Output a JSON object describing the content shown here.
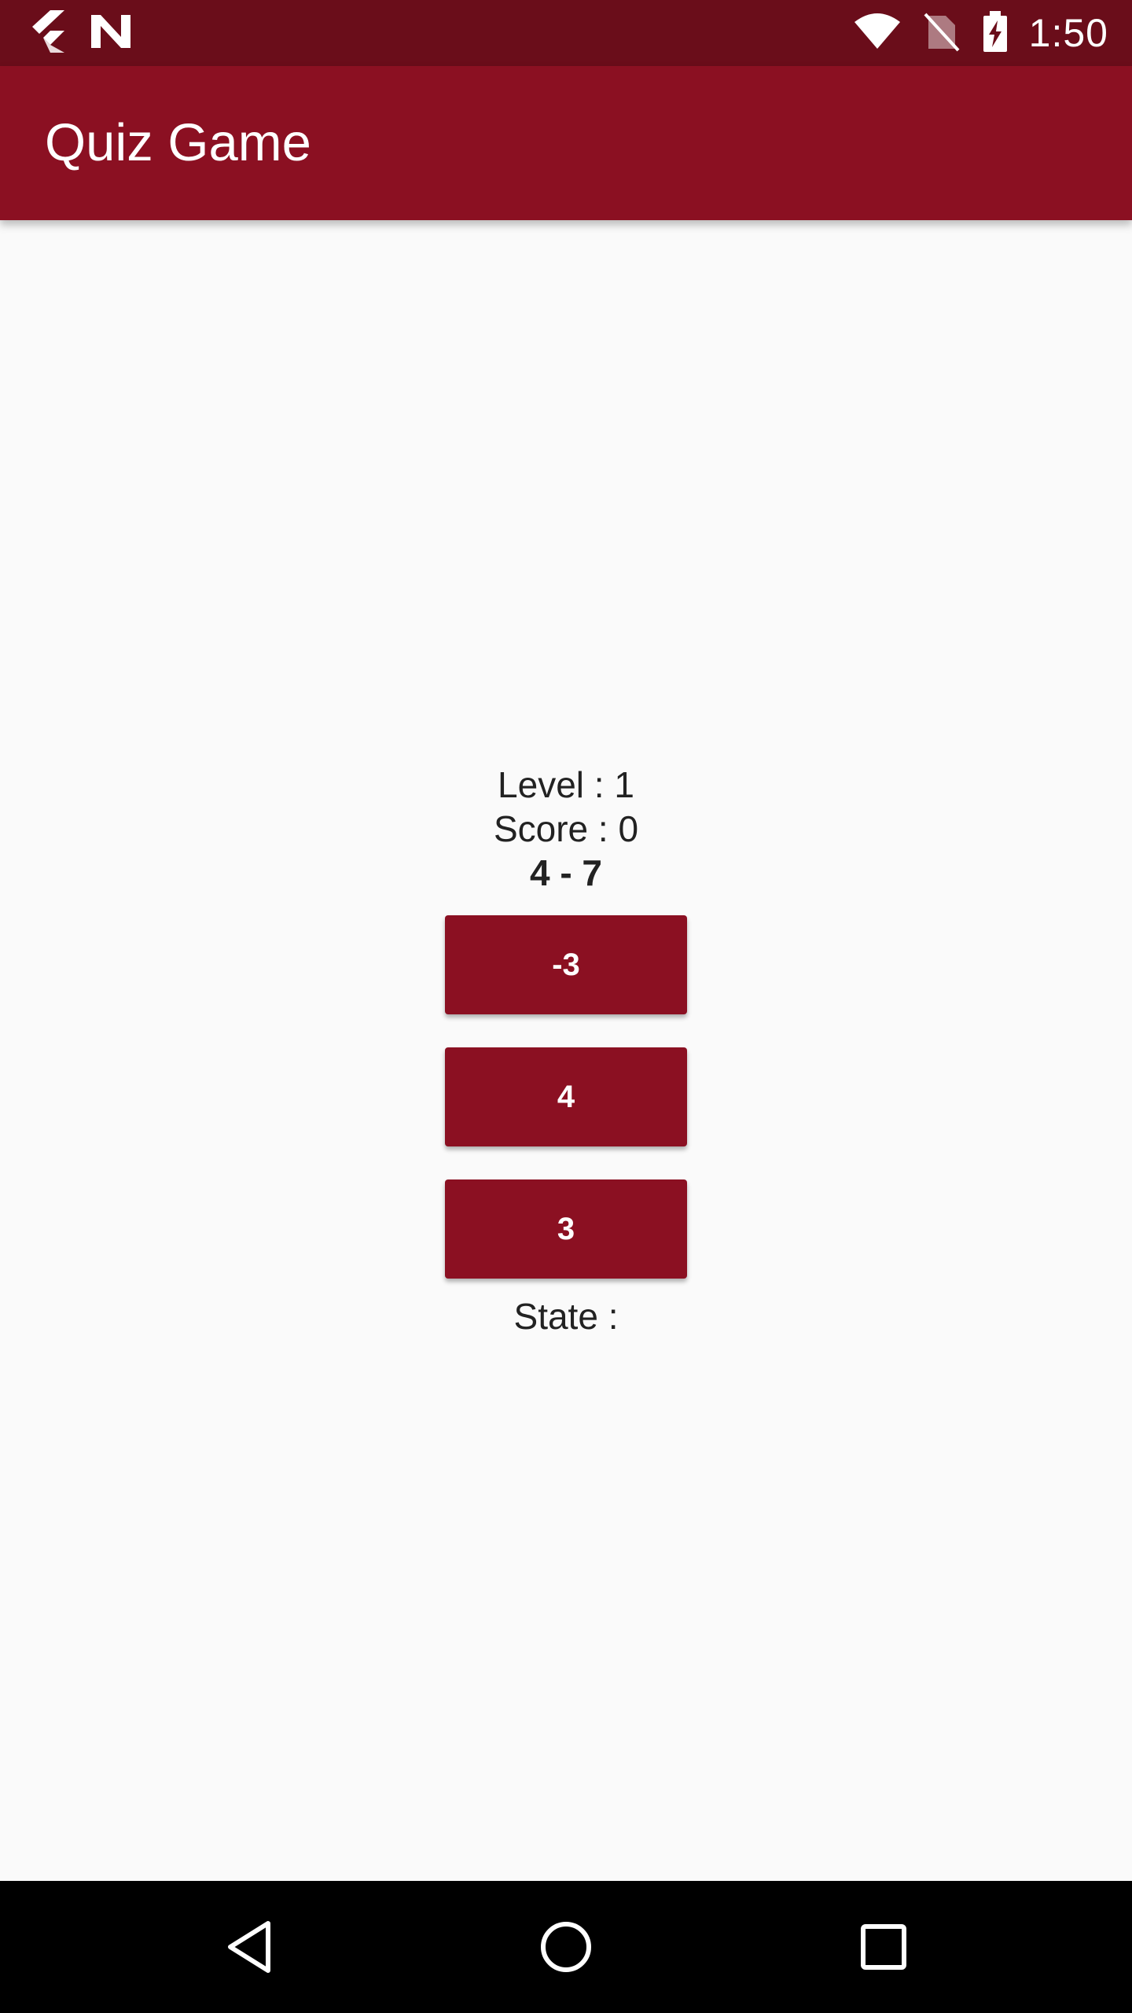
{
  "status_bar": {
    "time": "1:50",
    "icons": [
      "flutter-icon",
      "n-icon",
      "wifi-icon",
      "no-sim-icon",
      "battery-charging-icon"
    ]
  },
  "app_bar": {
    "title": "Quiz Game"
  },
  "quiz": {
    "level_text": "Level : 1",
    "score_text": "Score : 0",
    "question": "4 - 7",
    "answers": [
      "-3",
      "4",
      "3"
    ],
    "state_text": "State :"
  },
  "nav_bar": {
    "buttons": [
      "back-icon",
      "home-icon",
      "recents-icon"
    ]
  },
  "colors": {
    "status_bar": "#6a0d1a",
    "primary": "#8b1022",
    "background": "#fafafa",
    "text": "#222222"
  }
}
